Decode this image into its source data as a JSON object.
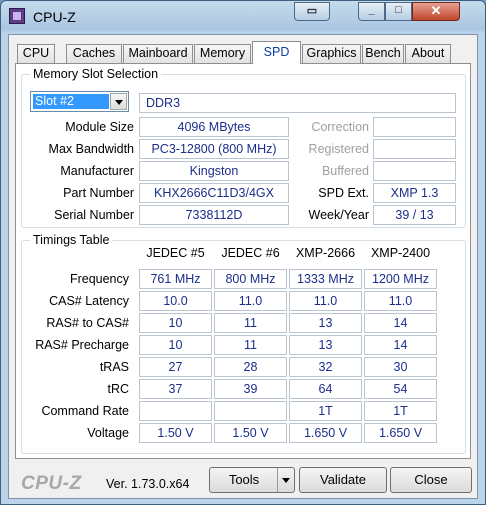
{
  "window": {
    "title": "CPU-Z"
  },
  "tabs": [
    "CPU",
    "Caches",
    "Mainboard",
    "Memory",
    "SPD",
    "Graphics",
    "Bench",
    "About"
  ],
  "active_tab": "SPD",
  "slot_group": {
    "title": "Memory Slot Selection",
    "slot_selected": "Slot #2",
    "memory_type": "DDR3",
    "labels": {
      "module_size": "Module Size",
      "max_bandwidth": "Max Bandwidth",
      "manufacturer": "Manufacturer",
      "part_number": "Part Number",
      "serial_number": "Serial Number",
      "correction": "Correction",
      "registered": "Registered",
      "buffered": "Buffered",
      "spd_ext": "SPD Ext.",
      "week_year": "Week/Year"
    },
    "values": {
      "module_size": "4096 MBytes",
      "max_bandwidth": "PC3-12800 (800 MHz)",
      "manufacturer": "Kingston",
      "part_number": "KHX2666C11D3/4GX",
      "serial_number": "7338112D",
      "correction": "",
      "registered": "",
      "buffered": "",
      "spd_ext": "XMP 1.3",
      "week_year": "39 / 13"
    }
  },
  "timings": {
    "title": "Timings Table",
    "columns": [
      "JEDEC #5",
      "JEDEC #6",
      "XMP-2666",
      "XMP-2400"
    ],
    "rows": [
      {
        "label": "Frequency",
        "cells": [
          "761 MHz",
          "800 MHz",
          "1333 MHz",
          "1200 MHz"
        ]
      },
      {
        "label": "CAS# Latency",
        "cells": [
          "10.0",
          "11.0",
          "11.0",
          "11.0"
        ]
      },
      {
        "label": "RAS# to CAS#",
        "cells": [
          "10",
          "11",
          "13",
          "14"
        ]
      },
      {
        "label": "RAS# Precharge",
        "cells": [
          "10",
          "11",
          "13",
          "14"
        ]
      },
      {
        "label": "tRAS",
        "cells": [
          "27",
          "28",
          "32",
          "30"
        ]
      },
      {
        "label": "tRC",
        "cells": [
          "37",
          "39",
          "64",
          "54"
        ]
      },
      {
        "label": "Command Rate",
        "cells": [
          "",
          "",
          "1T",
          "1T"
        ]
      },
      {
        "label": "Voltage",
        "cells": [
          "1.50 V",
          "1.50 V",
          "1.650 V",
          "1.650 V"
        ]
      }
    ]
  },
  "footer": {
    "brand": "CPU-Z",
    "version": "Ver. 1.73.0.x64",
    "tools_label": "Tools",
    "validate_label": "Validate",
    "close_label": "Close"
  },
  "colors": {
    "value_text": "#1c2e8c",
    "active_tab_text": "#0b3fa0",
    "selection": "#3399ff"
  }
}
